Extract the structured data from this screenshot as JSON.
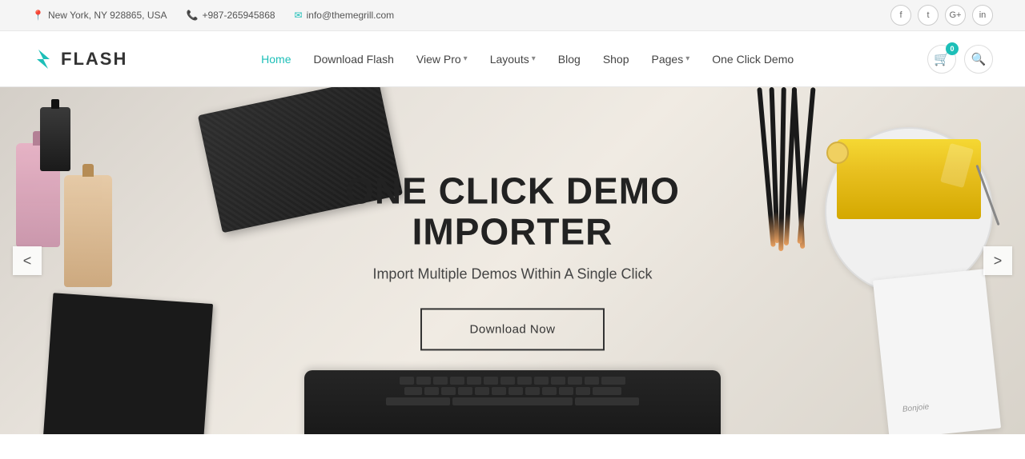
{
  "topbar": {
    "address": "New York, NY 928865, USA",
    "phone": "+987-265945868",
    "email": "info@themegrill.com",
    "social": [
      "f",
      "t",
      "G+",
      "in"
    ]
  },
  "header": {
    "logo_text": "FLASH",
    "nav": [
      {
        "label": "Home",
        "active": true,
        "has_dropdown": false
      },
      {
        "label": "Download Flash",
        "active": false,
        "has_dropdown": false
      },
      {
        "label": "View Pro",
        "active": false,
        "has_dropdown": true
      },
      {
        "label": "Layouts",
        "active": false,
        "has_dropdown": true
      },
      {
        "label": "Blog",
        "active": false,
        "has_dropdown": false
      },
      {
        "label": "Shop",
        "active": false,
        "has_dropdown": false
      },
      {
        "label": "Pages",
        "active": false,
        "has_dropdown": true
      },
      {
        "label": "One Click Demo",
        "active": false,
        "has_dropdown": false
      }
    ],
    "cart_count": "0",
    "accent_color": "#1dbfb8"
  },
  "hero": {
    "title": "ONE CLICK DEMO IMPORTER",
    "subtitle": "Import Multiple Demos Within A Single Click",
    "cta_label": "Download Now",
    "prev_label": "<",
    "next_label": ">"
  }
}
